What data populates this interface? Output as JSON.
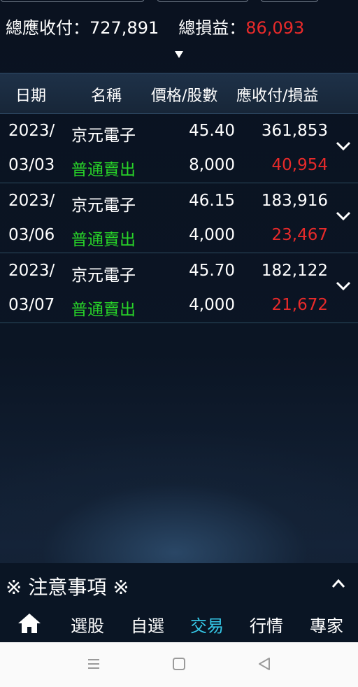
{
  "summary": {
    "receivable_label": "總應收付：",
    "receivable_value": "727,891",
    "pnl_label": "總損益：",
    "pnl_value": "86,093"
  },
  "table": {
    "headers": [
      "日期",
      "名稱",
      "價格/股數",
      "應收付/損益"
    ],
    "rows": [
      {
        "year": "2023/",
        "date": "03/03",
        "name": "京元電子",
        "type": "普通賣出",
        "price": "45.40",
        "shares": "8,000",
        "amount": "361,853",
        "pnl": "40,954"
      },
      {
        "year": "2023/",
        "date": "03/06",
        "name": "京元電子",
        "type": "普通賣出",
        "price": "46.15",
        "shares": "4,000",
        "amount": "183,916",
        "pnl": "23,467"
      },
      {
        "year": "2023/",
        "date": "03/07",
        "name": "京元電子",
        "type": "普通賣出",
        "price": "45.70",
        "shares": "4,000",
        "amount": "182,122",
        "pnl": "21,672"
      }
    ]
  },
  "notice": {
    "title": "※ 注意事項 ※"
  },
  "nav": {
    "items": [
      "選股",
      "自選",
      "交易",
      "行情",
      "專家"
    ],
    "active": "交易"
  },
  "colors": {
    "profit": "#e82a2a",
    "sell": "#28d428",
    "active_tab": "#35c7e6",
    "header_bg": "#1e3148"
  }
}
